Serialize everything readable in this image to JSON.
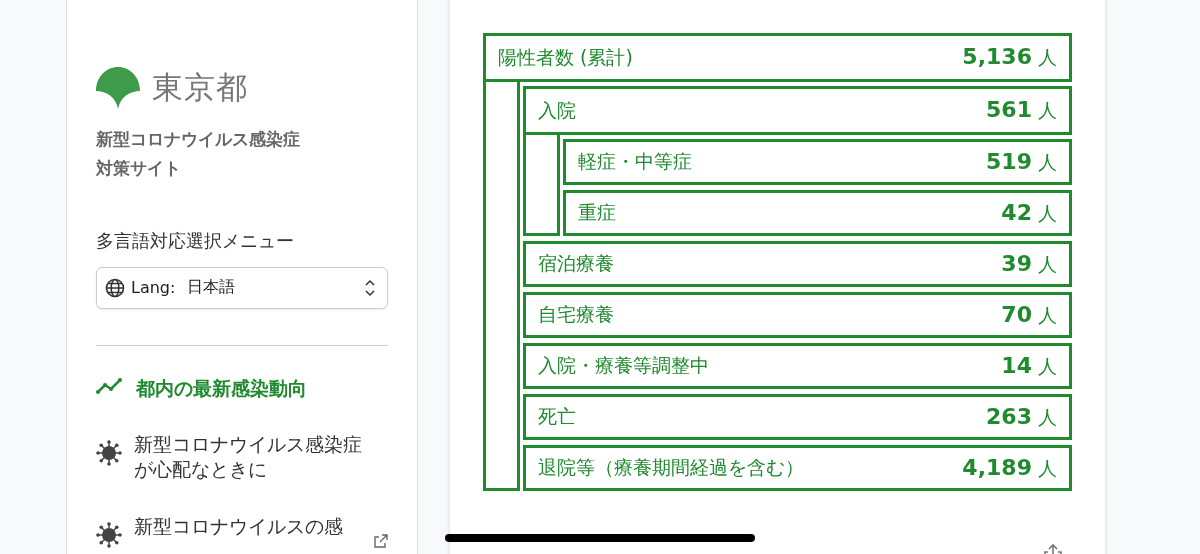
{
  "sidebar": {
    "logo_text": "東京都",
    "site_title": "新型コロナウイルス感染症対策サイト",
    "language_menu": {
      "label": "多言語対応選択メニュー",
      "prefix": "Lang:",
      "value": "日本語"
    },
    "nav": [
      {
        "kind": "chart",
        "label": "都内の最新感染動向",
        "selected": true,
        "external": false
      },
      {
        "kind": "virus",
        "label": "新型コロナウイルス感染症が心配なときに",
        "selected": false,
        "external": false
      },
      {
        "kind": "virus",
        "label": "新型コロナウイルスの感",
        "selected": false,
        "external": true
      }
    ]
  },
  "card": {
    "tree": {
      "label": "陽性者数 (累計)",
      "value": "5,136",
      "unit": "人",
      "children": [
        {
          "label": "入院",
          "value": "561",
          "unit": "人",
          "children": [
            {
              "label": "軽症・中等症",
              "value": "519",
              "unit": "人"
            },
            {
              "label": "重症",
              "value": "42",
              "unit": "人"
            }
          ]
        },
        {
          "label": "宿泊療養",
          "value": "39",
          "unit": "人"
        },
        {
          "label": "自宅療養",
          "value": "70",
          "unit": "人"
        },
        {
          "label": "入院・療養等調整中",
          "value": "14",
          "unit": "人"
        },
        {
          "label": "死亡",
          "value": "263",
          "unit": "人"
        },
        {
          "label": "退院等（療養期間経過を含む）",
          "value": "4,189",
          "unit": "人"
        }
      ]
    }
  }
}
